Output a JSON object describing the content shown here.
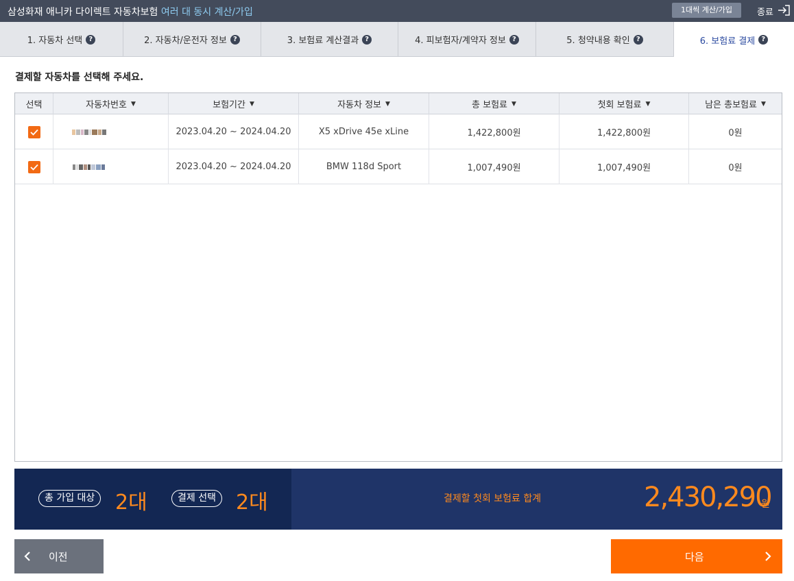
{
  "header": {
    "title": "삼성화재 애니카 다이렉트 자동차보험",
    "subtitle": "여러 대 동시 계산/가입",
    "one_at_a_time_button": "1대씩 계산/가입",
    "exit_label": "종료"
  },
  "steps": [
    {
      "label": "1. 자동차 선택",
      "active": false
    },
    {
      "label": "2. 자동차/운전자 정보",
      "active": false
    },
    {
      "label": "3. 보험료 계산결과",
      "active": false
    },
    {
      "label": "4. 피보험자/계약자 정보",
      "active": false
    },
    {
      "label": "5. 청약내용 확인",
      "active": false
    },
    {
      "label": "6. 보험료 결제",
      "active": true
    }
  ],
  "instruction": "결제할 자동차를 선택해 주세요.",
  "table": {
    "columns": [
      "선택",
      "자동차번호",
      "보험기간",
      "자동차 정보",
      "총 보험료",
      "첫회 보험료",
      "남은 총보험료"
    ],
    "rows": [
      {
        "selected": true,
        "car_number": "",
        "period": "2023.04.20 ~ 2024.04.20",
        "car_info": "X5 xDrive 45e xLine",
        "total_premium": "1,422,800원",
        "first_premium": "1,422,800원",
        "remaining": "0원"
      },
      {
        "selected": true,
        "car_number": "",
        "period": "2023.04.20 ~ 2024.04.20",
        "car_info": "BMW 118d Sport",
        "total_premium": "1,007,490원",
        "first_premium": "1,007,490원",
        "remaining": "0원"
      }
    ]
  },
  "summary": {
    "total_label": "총 가입 대상",
    "total_count": "2대",
    "selected_label": "결제 선택",
    "selected_count": "2대",
    "sum_label": "결제할 첫회 보험료 합계",
    "sum_amount": "2,430,290",
    "sum_unit": "원"
  },
  "buttons": {
    "prev": "이전",
    "next": "다음"
  },
  "colors": {
    "accent_orange": "#ff6a00",
    "navy": "#1f3468"
  }
}
